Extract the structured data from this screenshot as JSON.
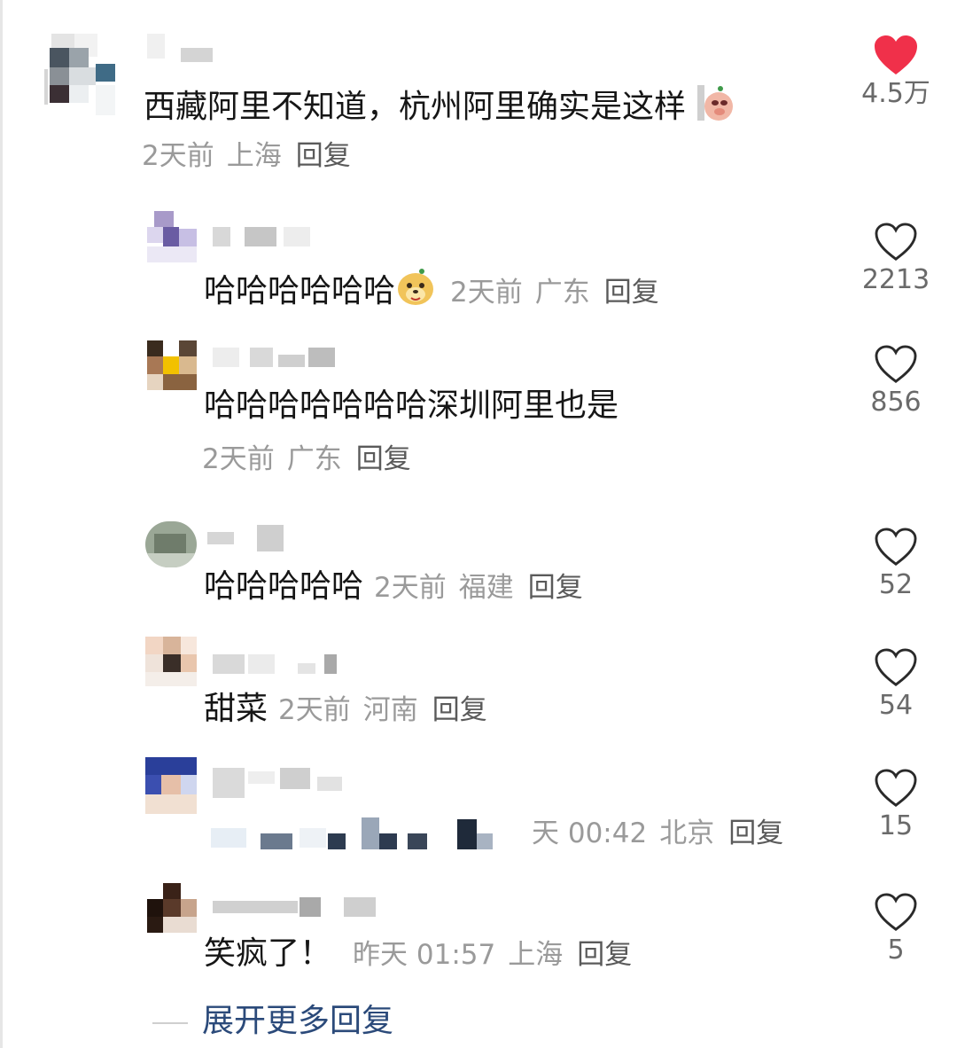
{
  "main_comment": {
    "text": "西藏阿里不知道，杭州阿里确实是这样",
    "time": "2天前",
    "location": "上海",
    "reply_label": "回复",
    "likes": "4.5万",
    "liked": true,
    "emoji": "pig-face-emoji"
  },
  "replies": [
    {
      "text": "哈哈哈哈哈哈",
      "time": "2天前",
      "location": "广东",
      "reply_label": "回复",
      "likes": "2213",
      "emoji": "dog-face-emoji"
    },
    {
      "text": "哈哈哈哈哈哈哈深圳阿里也是",
      "time": "2天前",
      "location": "广东",
      "reply_label": "回复",
      "likes": "856"
    },
    {
      "text": "哈哈哈哈哈",
      "time": "2天前",
      "location": "福建",
      "reply_label": "回复",
      "likes": "52"
    },
    {
      "text": "甜菜",
      "time": "2天前",
      "location": "河南",
      "reply_label": "回复",
      "likes": "54"
    },
    {
      "text": "",
      "time": "天 00:42",
      "location": "北京",
      "reply_label": "回复",
      "likes": "15"
    },
    {
      "text": "笑疯了！",
      "time": "昨天 01:57",
      "location": "上海",
      "reply_label": "回复",
      "likes": "5"
    }
  ],
  "expand_more": "展开更多回复",
  "colors": {
    "like_red": "#f0304a",
    "expand_blue": "#2b4a7a",
    "meta_gray": "#9a9a9a"
  }
}
